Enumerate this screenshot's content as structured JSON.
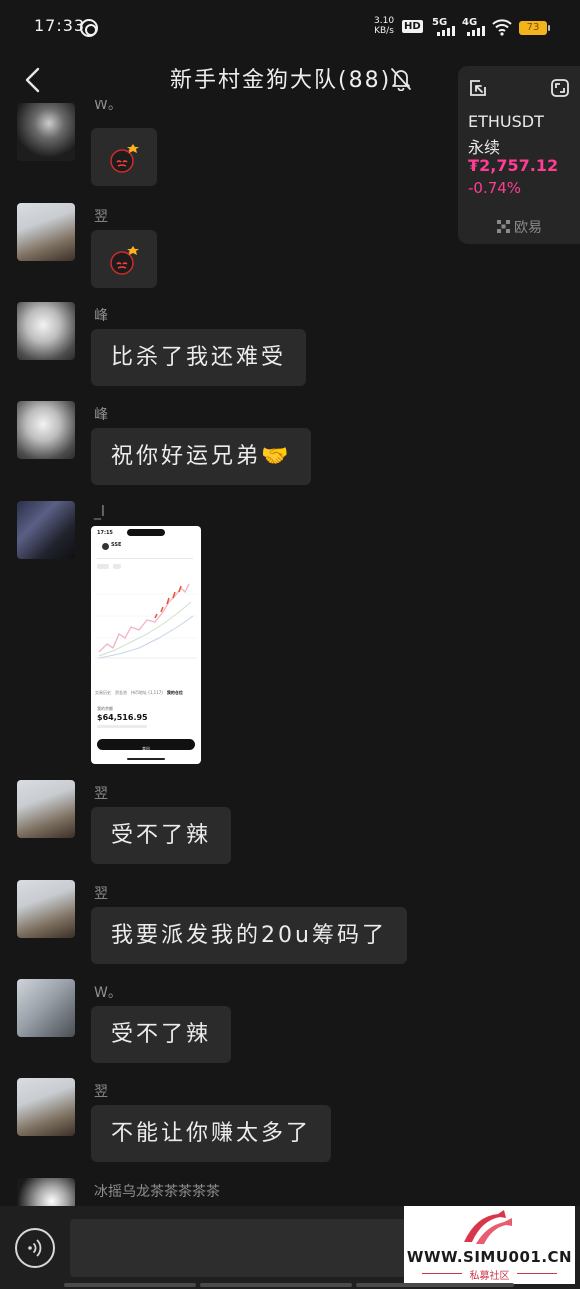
{
  "status_bar": {
    "time": "17:33",
    "net_speed_value": "3.10",
    "net_speed_unit": "KB/s",
    "hd_label": "HD",
    "sim1_network": "5G",
    "sim2_network": "4G",
    "battery": "73",
    "battery_color": "#f3b41b"
  },
  "header": {
    "title": "新手村金狗大队(88)",
    "back_icon": "chevron-left-icon",
    "mute_icon": "bell-slash-icon"
  },
  "messages": [
    {
      "sender": "W。",
      "type": "emoji",
      "emoji": "bomb"
    },
    {
      "sender": "翌",
      "type": "emoji",
      "emoji": "bomb"
    },
    {
      "sender": "峰",
      "type": "text",
      "text": "比杀了我还难受"
    },
    {
      "sender": "峰",
      "type": "text",
      "text": "祝你好运兄弟🤝"
    },
    {
      "sender": "_l",
      "type": "image",
      "image": {
        "time": "17:15",
        "token": "SSE",
        "balance_label": "我的余额",
        "balance": "$64,516.95",
        "tabs": [
          "交易历史",
          "资金池",
          "持币地址 (1,117)",
          "我的仓位"
        ],
        "button": "卖出"
      }
    },
    {
      "sender": "翌",
      "type": "text",
      "text": "受不了辣"
    },
    {
      "sender": "翌",
      "type": "text",
      "text": "我要派发我的20u筹码了"
    },
    {
      "sender": "W。",
      "type": "text",
      "text": "受不了辣"
    },
    {
      "sender": "翌",
      "type": "text",
      "text": "不能让你赚太多了"
    },
    {
      "sender": "冰摇乌龙茶茶茶茶茶",
      "type": "partial"
    }
  ],
  "widget": {
    "symbol": "ETHUSDT",
    "contract_type": "永续",
    "price": "₮2,757.12",
    "change": "-0.74%",
    "exchange": "欧易",
    "accent_color": "#ff3d93"
  },
  "input_bar": {
    "placeholder": "",
    "voice_icon": "voice-input-icon"
  },
  "watermark": {
    "url": "WWW.SIMU001.CN",
    "subtitle": "私募社区"
  }
}
